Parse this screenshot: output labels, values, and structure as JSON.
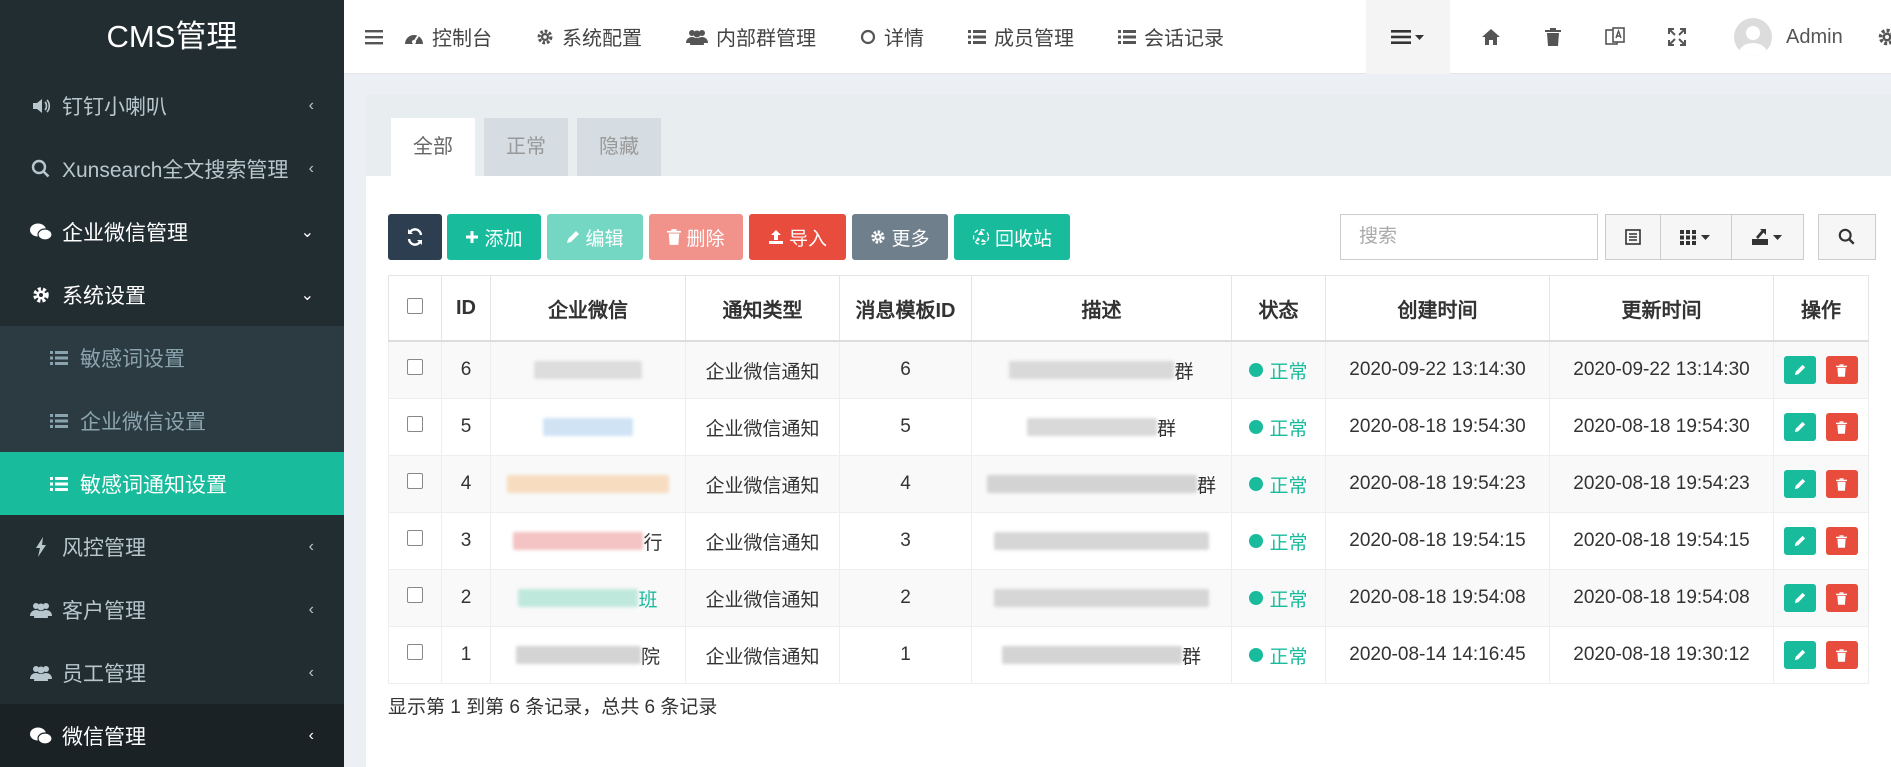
{
  "sidebar": {
    "logo": "CMS管理",
    "items": [
      {
        "label": "钉钉小喇叭",
        "icon": "volume-icon",
        "arrow": "chevron-left"
      },
      {
        "label": "Xunsearch全文搜索管理",
        "icon": "search-icon",
        "arrow": "chevron-left"
      },
      {
        "label": "企业微信管理",
        "icon": "wechat-icon",
        "arrow": "chevron-down"
      },
      {
        "label": "系统设置",
        "icon": "gear-icon",
        "arrow": "chevron-down"
      },
      {
        "label": "敏感词设置",
        "icon": "list-icon"
      },
      {
        "label": "企业微信设置",
        "icon": "list-icon"
      },
      {
        "label": "敏感词通知设置",
        "icon": "list-icon",
        "active": true
      },
      {
        "label": "风控管理",
        "icon": "bolt-icon",
        "arrow": "chevron-left"
      },
      {
        "label": "客户管理",
        "icon": "users-icon",
        "arrow": "chevron-left"
      },
      {
        "label": "员工管理",
        "icon": "users-icon",
        "arrow": "chevron-left"
      },
      {
        "label": "微信管理",
        "icon": "wechat-icon",
        "arrow": "chevron-left"
      }
    ]
  },
  "header": {
    "nav": [
      {
        "label": "控制台",
        "icon": "dashboard-icon"
      },
      {
        "label": "系统配置",
        "icon": "gear-icon"
      },
      {
        "label": "内部群管理",
        "icon": "users-icon"
      },
      {
        "label": "详情",
        "icon": "circle-icon"
      },
      {
        "label": "成员管理",
        "icon": "list-icon"
      },
      {
        "label": "会话记录",
        "icon": "list-icon"
      }
    ],
    "user": "Admin"
  },
  "tabs": [
    "全部",
    "正常",
    "隐藏"
  ],
  "toolbar": {
    "add": "添加",
    "edit": "编辑",
    "delete": "删除",
    "import": "导入",
    "more": "更多",
    "recycle": "回收站",
    "search_placeholder": "搜索"
  },
  "colors": {
    "primary": "#18bc9c",
    "dark": "#2c3e50",
    "danger": "#e74c3c",
    "gray": "#6f7f8c",
    "sidebar": "#222d32"
  },
  "table": {
    "columns": [
      "ID",
      "企业微信",
      "通知类型",
      "消息模板ID",
      "描述",
      "状态",
      "创建时间",
      "更新时间",
      "操作"
    ],
    "rows": [
      {
        "id": "6",
        "corp_suffix": "",
        "type": "企业微信通知",
        "template": "6",
        "desc_suffix": "群",
        "status": "正常",
        "created": "2020-09-22 13:14:30",
        "updated": "2020-09-22 13:14:30"
      },
      {
        "id": "5",
        "corp_suffix": "",
        "type": "企业微信通知",
        "template": "5",
        "desc_suffix": "群",
        "status": "正常",
        "created": "2020-08-18 19:54:30",
        "updated": "2020-08-18 19:54:30"
      },
      {
        "id": "4",
        "corp_suffix": "",
        "type": "企业微信通知",
        "template": "4",
        "desc_suffix": "群",
        "status": "正常",
        "created": "2020-08-18 19:54:23",
        "updated": "2020-08-18 19:54:23"
      },
      {
        "id": "3",
        "corp_suffix": "行",
        "type": "企业微信通知",
        "template": "3",
        "desc_suffix": "",
        "status": "正常",
        "created": "2020-08-18 19:54:15",
        "updated": "2020-08-18 19:54:15"
      },
      {
        "id": "2",
        "corp_suffix": "班",
        "type": "企业微信通知",
        "template": "2",
        "desc_suffix": "",
        "status": "正常",
        "created": "2020-08-18 19:54:08",
        "updated": "2020-08-18 19:54:08"
      },
      {
        "id": "1",
        "corp_suffix": "院",
        "type": "企业微信通知",
        "template": "1",
        "desc_suffix": "群",
        "status": "正常",
        "created": "2020-08-14 14:16:45",
        "updated": "2020-08-18 19:30:12"
      }
    ]
  },
  "footer": "显示第 1 到第 6 条记录，总共 6 条记录"
}
